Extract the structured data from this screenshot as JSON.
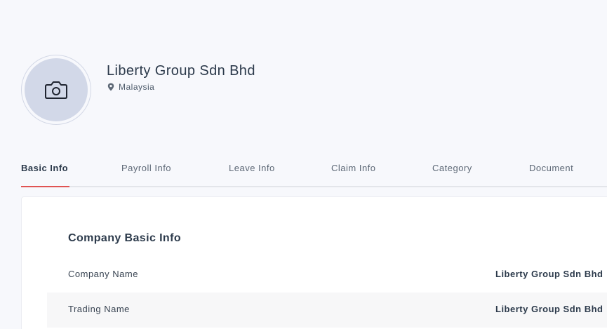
{
  "profile": {
    "company_name": "Liberty Group Sdn Bhd",
    "location": "Malaysia",
    "avatar_icon": "camera-icon",
    "location_icon": "map-pin-icon"
  },
  "tabs": [
    {
      "label": "Basic Info",
      "active": true
    },
    {
      "label": "Payroll Info",
      "active": false
    },
    {
      "label": "Leave Info",
      "active": false
    },
    {
      "label": "Claim Info",
      "active": false
    },
    {
      "label": "Category",
      "active": false
    },
    {
      "label": "Document",
      "active": false
    }
  ],
  "basic_info": {
    "title": "Company Basic Info",
    "rows": [
      {
        "label": "Company Name",
        "value": "Liberty Group Sdn Bhd"
      },
      {
        "label": "Trading Name",
        "value": "Liberty Group Sdn Bhd"
      }
    ]
  },
  "colors": {
    "accent": "#e05353",
    "background": "#f7f8fc",
    "avatar_fill": "#d2d8e8"
  }
}
